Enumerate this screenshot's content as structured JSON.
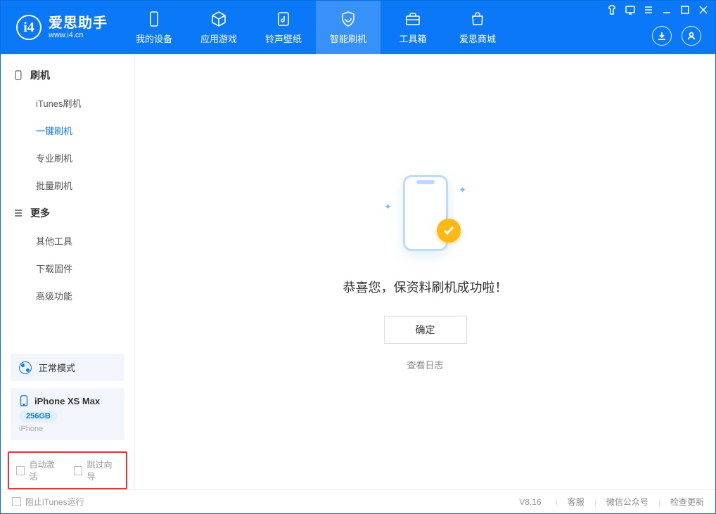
{
  "app": {
    "name": "爱思助手",
    "url": "www.i4.cn"
  },
  "nav": {
    "items": [
      {
        "label": "我的设备"
      },
      {
        "label": "应用游戏"
      },
      {
        "label": "铃声壁纸"
      },
      {
        "label": "智能刷机"
      },
      {
        "label": "工具箱"
      },
      {
        "label": "爱思商城"
      }
    ]
  },
  "sidebar": {
    "group1_title": "刷机",
    "group1_items": [
      "iTunes刷机",
      "一键刷机",
      "专业刷机",
      "批量刷机"
    ],
    "group2_title": "更多",
    "group2_items": [
      "其他工具",
      "下载固件",
      "高级功能"
    ],
    "mode_label": "正常模式",
    "device_name": "iPhone XS Max",
    "device_storage": "256GB",
    "device_type": "iPhone",
    "chk_auto_activate": "自动激活",
    "chk_skip_guide": "跳过向导"
  },
  "main": {
    "success_text": "恭喜您，保资料刷机成功啦！",
    "ok_button": "确定",
    "log_link": "查看日志"
  },
  "statusbar": {
    "block_itunes": "阻止iTunes运行",
    "version": "V8.16",
    "links": [
      "客服",
      "微信公众号",
      "检查更新"
    ]
  }
}
